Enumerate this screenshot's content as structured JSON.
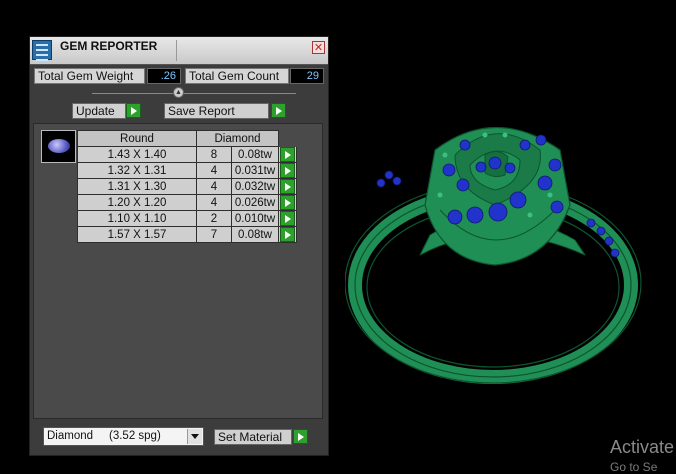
{
  "window": {
    "title": "GEM REPORTER",
    "close_glyph": "✕"
  },
  "stats": {
    "weight_label": "Total Gem Weight",
    "weight_value": ".26",
    "count_label": "Total Gem Count",
    "count_value": "29"
  },
  "actions": {
    "update_label": "Update",
    "save_label": "Save Report"
  },
  "table": {
    "shape_header": "Round",
    "material_header": "Diamond",
    "rows": [
      {
        "size": "1.43 X 1.40",
        "count": "8",
        "weight": "0.08tw"
      },
      {
        "size": "1.32 X 1.31",
        "count": "4",
        "weight": "0.031tw"
      },
      {
        "size": "1.31 X 1.30",
        "count": "4",
        "weight": "0.032tw"
      },
      {
        "size": "1.20 X 1.20",
        "count": "4",
        "weight": "0.026tw"
      },
      {
        "size": "1.10 X 1.10",
        "count": "2",
        "weight": "0.010tw"
      },
      {
        "size": "1.57 X 1.57",
        "count": "7",
        "weight": "0.08tw"
      }
    ]
  },
  "material": {
    "selected": "Diamond     (3.52 spg)",
    "set_label": "Set Material"
  },
  "os_watermark": {
    "line1": "Activate",
    "line2": "Go to Se"
  },
  "colors": {
    "ring_green": "#1f8f55",
    "gem_blue": "#2233cc",
    "go_green": "#2ea02e"
  },
  "icons": [
    "app-icon",
    "close-icon",
    "slider-knob",
    "arrow-right-icon",
    "chevron-down-icon",
    "gem-thumbnail"
  ]
}
